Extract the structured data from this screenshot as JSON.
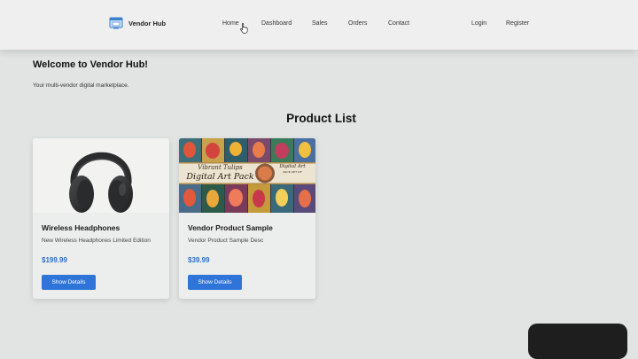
{
  "navbar": {
    "brand": "Vendor Hub",
    "links": {
      "home": "Home",
      "dashboard": "Dashboard",
      "sales": "Sales",
      "orders": "Orders",
      "contact": "Contact",
      "login": "Login",
      "register": "Register"
    }
  },
  "welcome": {
    "title": "Welcome to Vendor Hub!",
    "subtitle": "Your multi-vendor digital marketplace."
  },
  "products": {
    "heading": "Product List",
    "items": [
      {
        "title": "Wireless Headphones",
        "description": "New Wireless Headphones Limited Edition",
        "price": "$199.99",
        "button": "Show Details",
        "image": "headphones"
      },
      {
        "title": "Vendor Product Sample",
        "description": "Vendor Product Sample Desc",
        "price": "$39.99",
        "button": "Show Details",
        "image": "tulip-art-pack",
        "image_text": {
          "line1": "Vibrant Tulips",
          "line2": "Digital Art Pack",
          "badge_line1": "Digital Art",
          "badge_line2": "PACK SET OF"
        }
      }
    ]
  },
  "colors": {
    "accent": "#2f74d8",
    "price": "#2d6fcf",
    "page_bg": "#e1e4e2",
    "navbar_bg": "#eeefee"
  },
  "icons": [
    "storefront-icon",
    "pointer-cursor-icon"
  ]
}
